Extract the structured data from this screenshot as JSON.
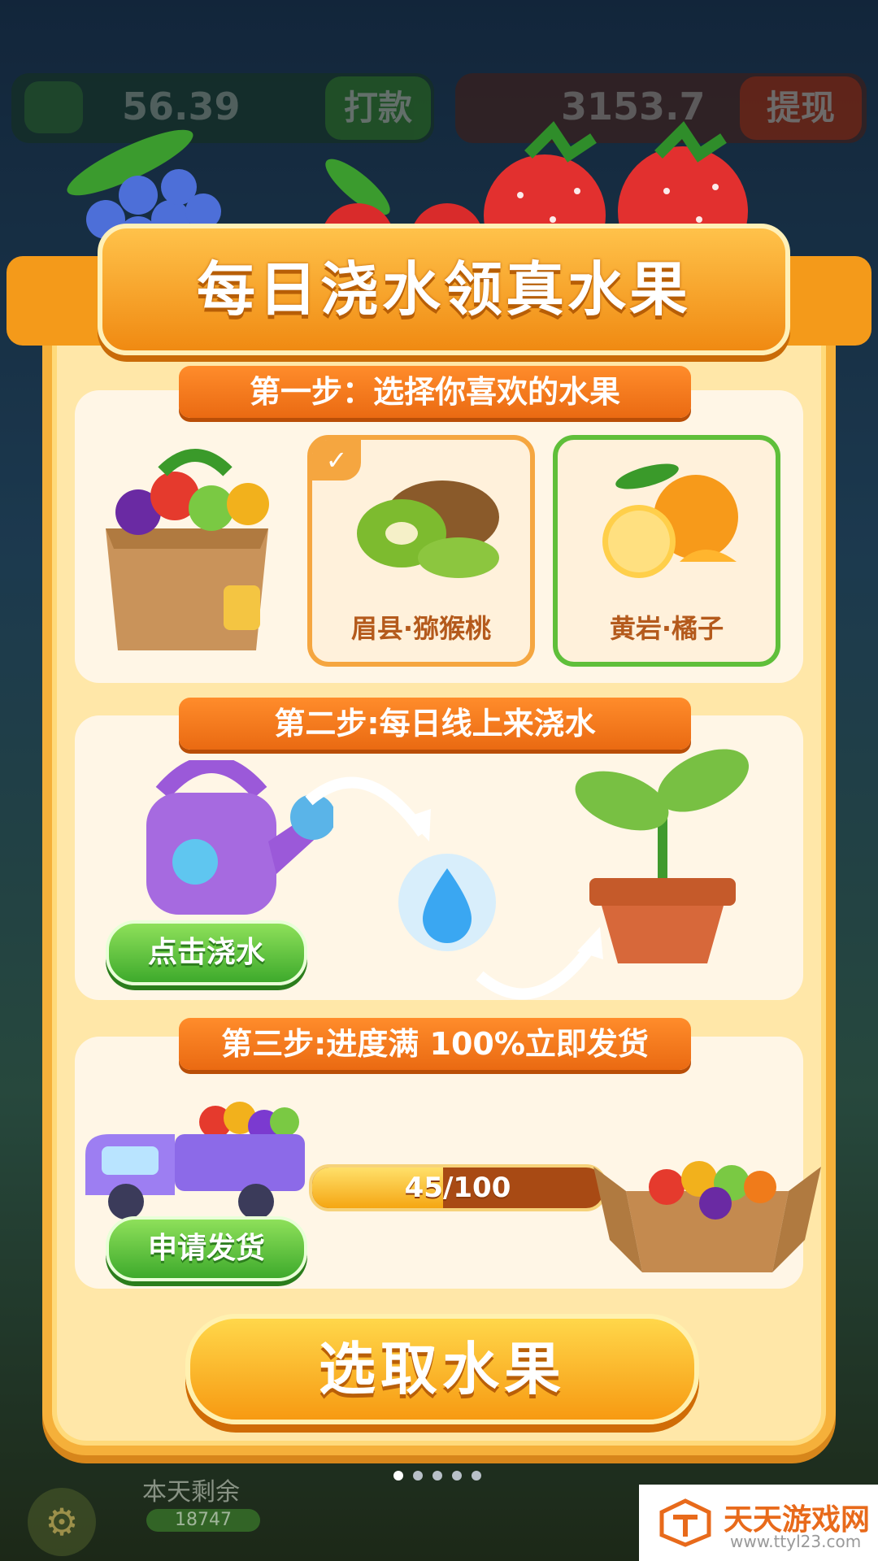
{
  "hud": {
    "cash_value": "56.39",
    "cash_button": "打款",
    "coin_value": "3153.7",
    "coin_button": "提现",
    "remaining_label": "本天剩余",
    "remaining_value": "18747"
  },
  "modal": {
    "title": "每日浇水领真水果",
    "step1": {
      "label": "第一步：选择你喜欢的水果",
      "options": [
        {
          "label": "眉县·猕猴桃",
          "selected": true
        },
        {
          "label": "黄岩·橘子",
          "selected": false
        }
      ]
    },
    "step2": {
      "label": "第二步:每日线上来浇水",
      "water_button": "点击浇水"
    },
    "step3": {
      "label": "第三步:进度满 100%立即发货",
      "progress_text": "45/100",
      "progress_value": 0.45,
      "ship_button": "申请发货"
    },
    "primary_button": "选取水果"
  },
  "pager": {
    "count": 5,
    "active_index": 0
  },
  "watermark": {
    "title": "天天游戏网",
    "url": "www.ttyl23.com"
  },
  "colors": {
    "accent_orange": "#f08a12",
    "green": "#3eaa2c",
    "panel": "#ffe7a8"
  }
}
